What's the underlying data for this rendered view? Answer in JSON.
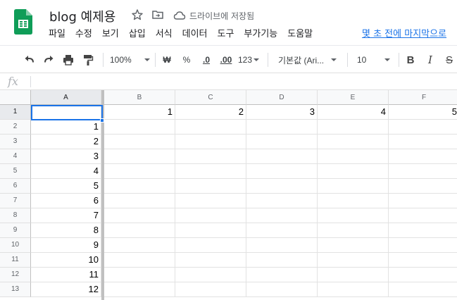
{
  "doc": {
    "title": "blog 예제용",
    "save_status": "드라이브에 저장됨"
  },
  "menu": [
    "파일",
    "수정",
    "보기",
    "삽입",
    "서식",
    "데이터",
    "도구",
    "부가기능",
    "도움말"
  ],
  "last_edit": "몇 초 전에 마지막으로",
  "toolbar": {
    "zoom": "100%",
    "currency": "₩",
    "percent": "%",
    "decimal_decrease": ".0",
    "decimal_increase": ".00",
    "more_formats": "123",
    "font": "기본값 (Ari...",
    "font_size": "10",
    "bold": "B",
    "italic": "I",
    "strike": "S"
  },
  "formula_bar": {
    "fx": "fx",
    "content": ""
  },
  "grid": {
    "columns": [
      "A",
      "B",
      "C",
      "D",
      "E",
      "F"
    ],
    "rows": [
      "1",
      "2",
      "3",
      "4",
      "5",
      "6",
      "7",
      "8",
      "9",
      "10",
      "11",
      "12",
      "13"
    ],
    "row1": {
      "B": "1",
      "C": "2",
      "D": "3",
      "E": "4",
      "F": "5"
    },
    "colA": [
      "",
      "1",
      "2",
      "3",
      "4",
      "5",
      "6",
      "7",
      "8",
      "9",
      "10",
      "11",
      "12"
    ]
  },
  "icons": {
    "logo": "google-sheets-logo",
    "star": "star-icon",
    "move": "move-to-folder-icon",
    "cloud": "cloud-saved-icon",
    "undo": "undo-icon",
    "redo": "redo-icon",
    "print": "print-icon",
    "paint_format": "paint-format-icon"
  },
  "colors": {
    "sheets_green": "#0f9d58",
    "accent_blue": "#1a73e8"
  }
}
